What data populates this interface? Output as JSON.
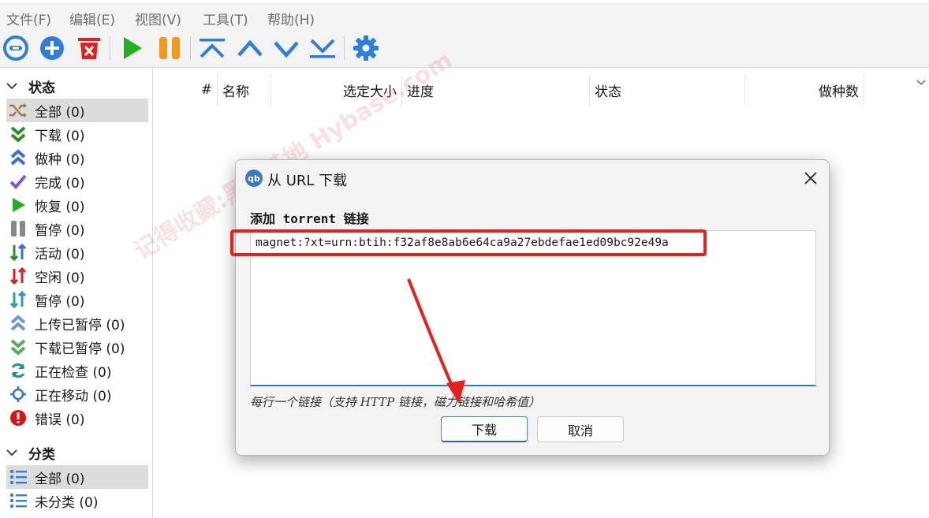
{
  "menubar": {
    "items": [
      "文件(F)",
      "编辑(E)",
      "视图(V)",
      "工具(T)",
      "帮助(H)"
    ]
  },
  "toolbar": {
    "icons": [
      "link-icon",
      "add-icon",
      "delete-icon",
      "play-icon",
      "pause-icon",
      "move-top-icon",
      "move-up-icon",
      "move-down-icon",
      "move-bottom-icon",
      "gear-icon"
    ]
  },
  "sidebar": {
    "status_title": "状态",
    "status_items": [
      {
        "label": "全部 (0)",
        "icon": "shuffle-icon",
        "color": "#a07a4a"
      },
      {
        "label": "下载 (0)",
        "icon": "double-chevron-down-icon",
        "color": "#2e8b2e"
      },
      {
        "label": "做种 (0)",
        "icon": "double-chevron-up-icon",
        "color": "#3a6fd8"
      },
      {
        "label": "完成 (0)",
        "icon": "checkmark-icon",
        "color": "#8a4fd0"
      },
      {
        "label": "恢复 (0)",
        "icon": "play-icon",
        "color": "#2aaa2a"
      },
      {
        "label": "暂停 (0)",
        "icon": "pause-icon",
        "color": "#888888"
      },
      {
        "label": "活动 (0)",
        "icon": "up-down-arrows-icon",
        "color": "#2e8b2e"
      },
      {
        "label": "空闲 (0)",
        "icon": "up-down-arrows-icon",
        "color": "#e02020"
      },
      {
        "label": "暂停 (0)",
        "icon": "up-down-arrows-icon",
        "color": "#2aa0a0"
      },
      {
        "label": "上传已暂停 (0)",
        "icon": "double-chevron-up-icon",
        "color": "#6f95d8"
      },
      {
        "label": "下载已暂停 (0)",
        "icon": "double-chevron-down-icon",
        "color": "#5aaa5a"
      },
      {
        "label": "正在检查 (0)",
        "icon": "refresh-icon",
        "color": "#1f8f8f"
      },
      {
        "label": "正在移动 (0)",
        "icon": "target-icon",
        "color": "#3a78c3"
      },
      {
        "label": "错误 (0)",
        "icon": "error-icon",
        "color": "#e01010"
      }
    ],
    "category_title": "分类",
    "category_items": [
      {
        "label": "全部 (0)",
        "icon": "list-icon"
      },
      {
        "label": "未分类 (0)",
        "icon": "list-icon"
      }
    ]
  },
  "table": {
    "columns": [
      "#",
      "名称",
      "选定大小",
      "进度",
      "状态",
      "做种数"
    ]
  },
  "dialog": {
    "title": "从 URL 下载",
    "logo": "qb",
    "label": "添加 torrent 链接",
    "url_value": "magnet:?xt=urn:btih:f32af8e8ab6e64ca9a27ebdefae1ed09bc92e49a",
    "hint": "每行一个链接（支持 HTTP 链接，磁力链接和哈希值）",
    "download_button": "下载",
    "cancel_button": "取消"
  },
  "watermark": "记得收藏:黑域基地 Hybase.com",
  "colors": {
    "accent": "#3a74c4",
    "annotation_red": "#e8201c"
  }
}
